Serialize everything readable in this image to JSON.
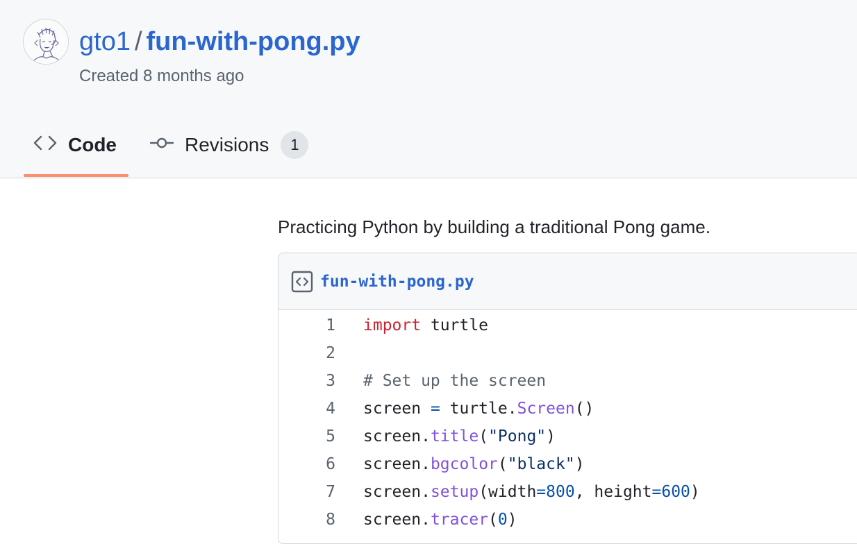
{
  "header": {
    "owner": "gto1",
    "separator": "/",
    "gist_name": "fun-with-pong.py",
    "created": "Created 8 months ago"
  },
  "tabs": {
    "code": {
      "label": "Code",
      "icon": "code-icon"
    },
    "revisions": {
      "label": "Revisions",
      "icon": "git-commit-icon",
      "count": "1"
    }
  },
  "description": "Practicing Python by building a traditional Pong game.",
  "file": {
    "icon": "file-code-icon",
    "name": "fun-with-pong.py",
    "lines": [
      {
        "n": "1",
        "code": "import turtle"
      },
      {
        "n": "2",
        "code": ""
      },
      {
        "n": "3",
        "code": "# Set up the screen"
      },
      {
        "n": "4",
        "code": "screen = turtle.Screen()"
      },
      {
        "n": "5",
        "code": "screen.title(\"Pong\")"
      },
      {
        "n": "6",
        "code": "screen.bgcolor(\"black\")"
      },
      {
        "n": "7",
        "code": "screen.setup(width=800, height=600)"
      },
      {
        "n": "8",
        "code": "screen.tracer(0)"
      }
    ]
  },
  "colors": {
    "link": "#2b66cf",
    "tab_underline": "#fd8c73",
    "header_bg": "#f6f8fa",
    "keyword": "#cf222e",
    "comment": "#59636e",
    "function": "#953800",
    "method": "#8250df",
    "string": "#0a3069",
    "number": "#0550ae"
  }
}
